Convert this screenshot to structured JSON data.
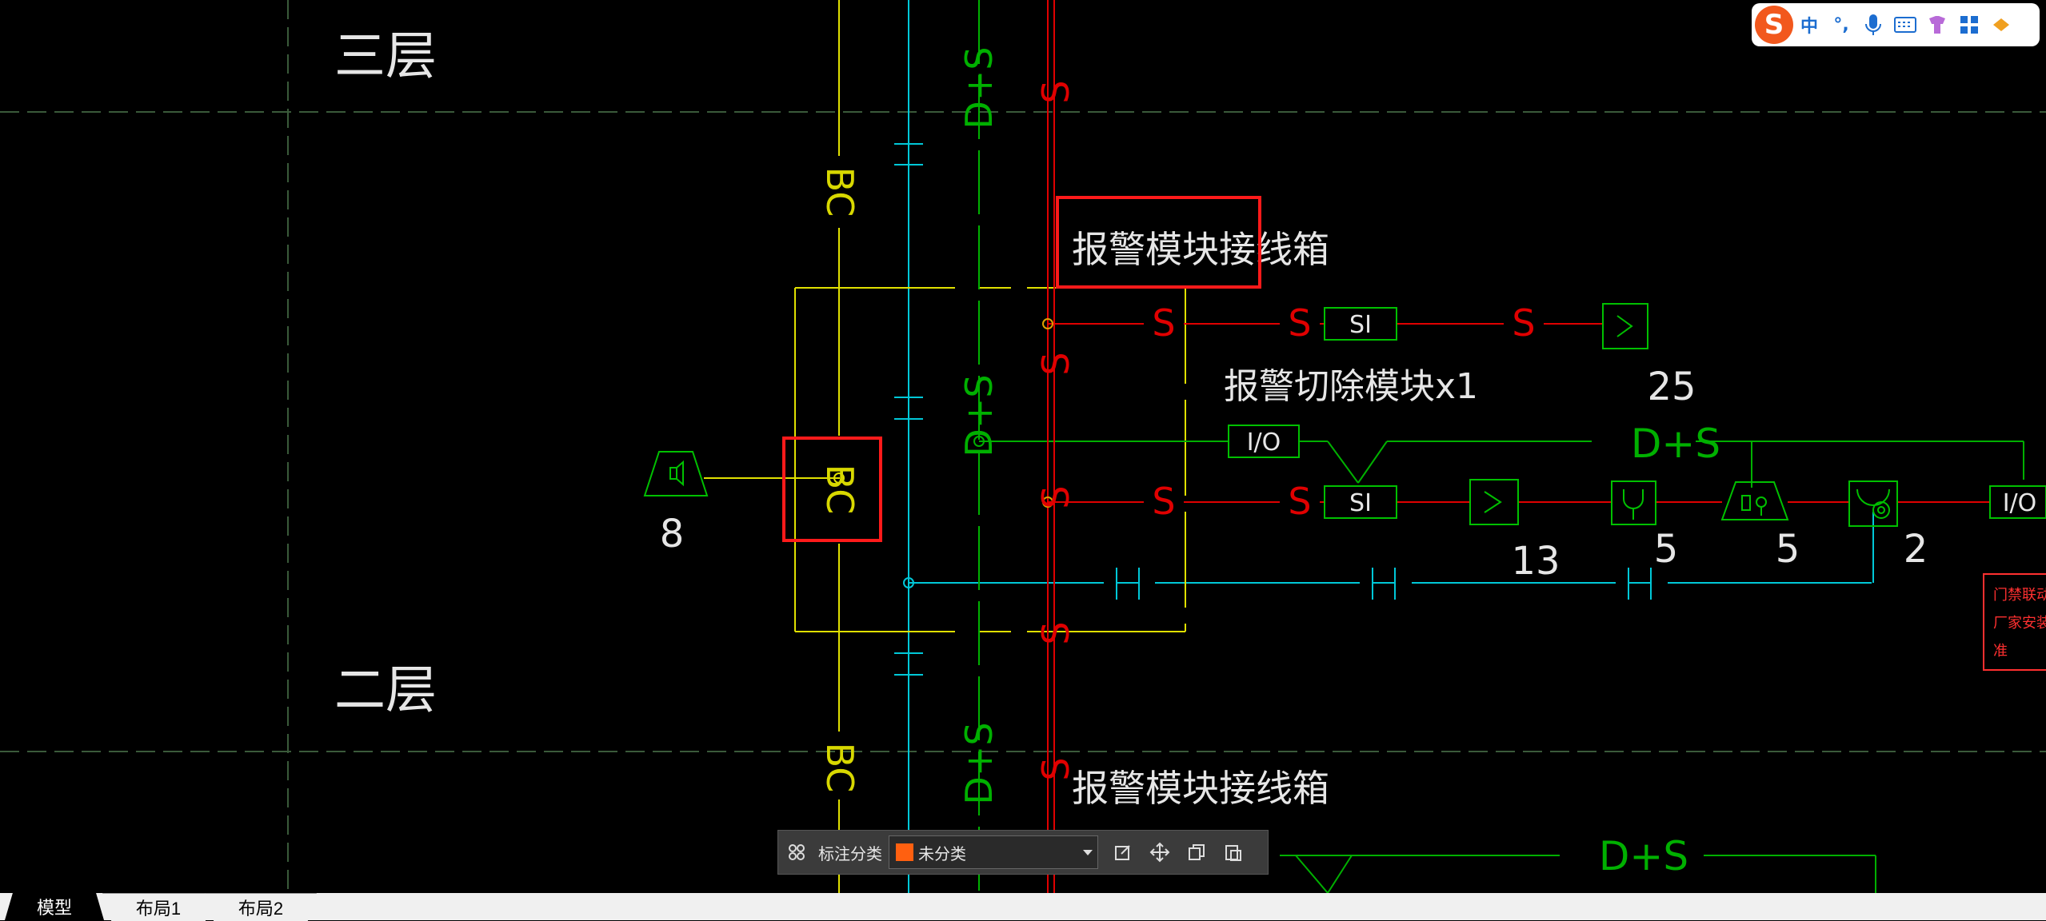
{
  "cad": {
    "floor_upper": "三层",
    "floor_lower": "二层",
    "bus_labels": {
      "bc": "BC",
      "ds": "D+S",
      "s": "S"
    },
    "box_label_top": "报警模块接线箱",
    "box_label_bottom": "报警模块接线箱",
    "cut_module": "报警切除模块x1",
    "si": "SI",
    "io": "I/O",
    "counts": {
      "speaker": "8",
      "smoke_top": "25",
      "smoke_bottom": "13",
      "heat": "5",
      "manual": "5",
      "hydrant": "2"
    },
    "note_lines": [
      "门禁联动联",
      "厂家安装数",
      "准"
    ],
    "colors": {
      "red": "#ff0000",
      "cyan": "#00ffff",
      "yellow": "#ffff00",
      "green": "#00c000",
      "highlight": "#ff1a1a"
    }
  },
  "ime": {
    "logo": "S",
    "lang": "中",
    "punct": "°,",
    "icons": [
      "mic-icon",
      "keyboard-icon",
      "skin-icon",
      "toolbox-icon",
      "more-icon"
    ]
  },
  "annotation_toolbar": {
    "label": "标注分类",
    "category": "未分类",
    "category_color": "#ff6010"
  },
  "tabs": [
    "模型",
    "布局1",
    "布局2"
  ]
}
